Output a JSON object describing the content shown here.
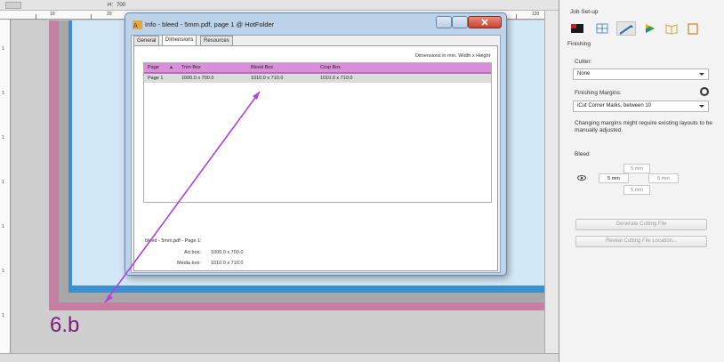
{
  "toolbar": {
    "h_label": "H:",
    "h_value": "700",
    "ruler_top_labels": [
      "10",
      "20",
      "120"
    ],
    "ruler_left_labels": [
      "1",
      "1",
      "1",
      "1",
      "1",
      "1",
      "1"
    ]
  },
  "dialog": {
    "title": "Info - bleed - 5mm.pdf, page 1 @ HotFolder",
    "tabs": [
      "General",
      "Dimensions",
      "Resources"
    ],
    "active_tab": "Dimensions",
    "units_note": "Dimensions in mm. Width x Height",
    "columns": [
      "Page",
      "Trim Box",
      "Bleed Box",
      "Crop Box"
    ],
    "rows": [
      {
        "page": "Page 1",
        "trim": "1000.0 x 700.0",
        "bleed": "1010.0 x 710.0",
        "crop": "1010.0 x 710.0"
      }
    ],
    "info": {
      "heading": "bleed - 5mm.pdf - Page 1:",
      "art_label": "Art box:",
      "art_value": "1000.0 x 700.0",
      "media_label": "Media box:",
      "media_value": "1010.0 x 710.0"
    }
  },
  "panel": {
    "job_setup": "Job Set-up",
    "finishing": "Finishing",
    "cutter_label": "Cutter:",
    "cutter_value": "None",
    "margins_label": "Finishing Margins:",
    "margins_value": "iCut Corner Marks, between 10",
    "warning": "Changing margins might require existing layouts to be manually adjusted.",
    "bleed_label": "Bleed",
    "bleed_top": "5 mm",
    "bleed_left": "5 mm",
    "bleed_right": "5 mm",
    "bleed_bottom": "5 mm",
    "generate_btn": "Generate Cutting File",
    "reveal_btn": "Reveal Cutting File Location..."
  },
  "annotation": {
    "label": "6.b",
    "color": "#b040e0"
  },
  "colors": {
    "bleed_frame": "#c77fa2",
    "page_area": "#d3e8f6",
    "blue_frame": "#3c8fd1",
    "grid_header": "#d98fd9"
  }
}
